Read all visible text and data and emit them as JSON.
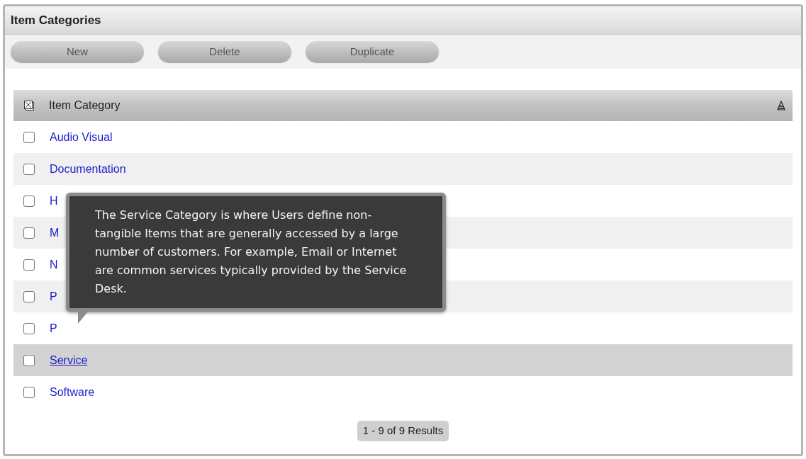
{
  "panel": {
    "title": "Item Categories"
  },
  "toolbar": [
    "New",
    "Delete",
    "Duplicate"
  ],
  "table": {
    "column": "Item Category",
    "rows": [
      {
        "label": "Audio Visual",
        "checked": false,
        "selected": false
      },
      {
        "label": "Documentation",
        "checked": false,
        "selected": false
      },
      {
        "label": "H",
        "checked": false,
        "selected": false
      },
      {
        "label": "M",
        "checked": false,
        "selected": false
      },
      {
        "label": "N",
        "checked": false,
        "selected": false
      },
      {
        "label": "P",
        "checked": false,
        "selected": false
      },
      {
        "label": "P",
        "checked": false,
        "selected": false
      },
      {
        "label": "Service",
        "checked": false,
        "selected": true
      },
      {
        "label": "Software",
        "checked": false,
        "selected": false
      }
    ]
  },
  "tooltip": "The Service Category is where Users define non-tangible Items that are generally accessed by a large number of customers. For example, Email or Internet are common services typically provided by the Service Desk.",
  "pagination": "1 - 9 of 9 Results"
}
